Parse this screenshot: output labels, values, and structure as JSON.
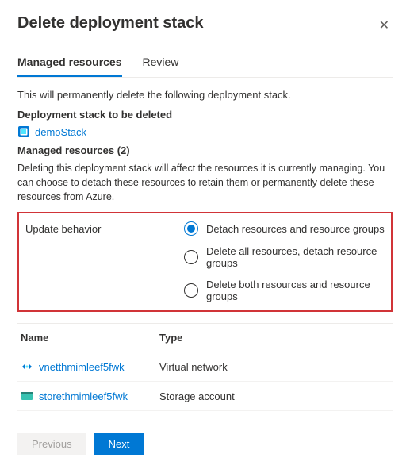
{
  "header": {
    "title": "Delete deployment stack"
  },
  "tabs": {
    "managed": "Managed resources",
    "review": "Review"
  },
  "intro": "This will permanently delete the following deployment stack.",
  "stack": {
    "heading": "Deployment stack to be deleted",
    "name": "demoStack"
  },
  "managed": {
    "heading": "Managed resources (2)",
    "note": "Deleting this deployment stack will affect the resources it is currently managing. You can choose to detach these resources to retain them or permanently delete these resources from Azure."
  },
  "behavior": {
    "label": "Update behavior",
    "options": [
      "Detach resources and resource groups",
      "Delete all resources, detach resource groups",
      "Delete both resources and resource groups"
    ]
  },
  "table": {
    "col_name": "Name",
    "col_type": "Type",
    "rows": [
      {
        "name": "vnetthmimleef5fwk",
        "type": "Virtual network"
      },
      {
        "name": "storethmimleef5fwk",
        "type": "Storage account"
      }
    ]
  },
  "buttons": {
    "prev": "Previous",
    "next": "Next"
  }
}
